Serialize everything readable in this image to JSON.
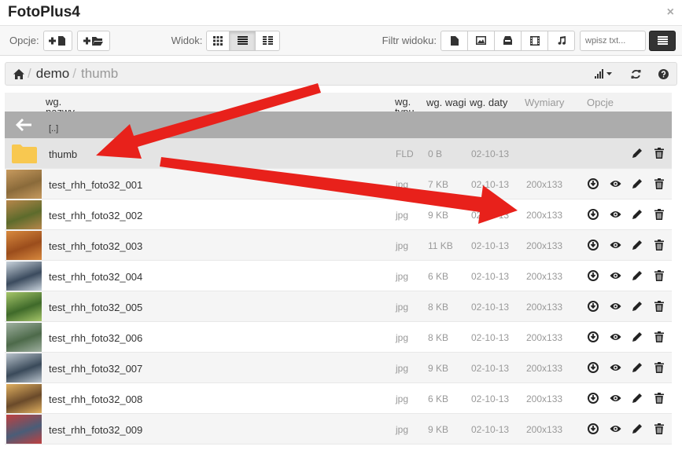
{
  "app": {
    "title": "FotoPlus4",
    "close_glyph": "×"
  },
  "toolbar": {
    "options_label": "Opcje:",
    "view_label": "Widok:",
    "filter_label": "Filtr widoku:",
    "search_placeholder": "wpisz txt..."
  },
  "breadcrumb": {
    "items": [
      "demo",
      "thumb"
    ],
    "separator": "/"
  },
  "columns": {
    "name": "wg. nazwy",
    "type": "wg. typu",
    "size": "wg. wagi",
    "date": "wg. daty",
    "dimensions": "Wymiary",
    "options": "Opcje"
  },
  "parent_label": "[..]",
  "rows": [
    {
      "name": "thumb",
      "type": "FLD",
      "size": "0 B",
      "date": "02-10-13",
      "dim": ""
    },
    {
      "name": "test_rhh_foto32_001",
      "type": "jpg",
      "size": "7 KB",
      "date": "02-10-13",
      "dim": "200x133"
    },
    {
      "name": "test_rhh_foto32_002",
      "type": "jpg",
      "size": "9 KB",
      "date": "02-10-13",
      "dim": "200x133"
    },
    {
      "name": "test_rhh_foto32_003",
      "type": "jpg",
      "size": "11 KB",
      "date": "02-10-13",
      "dim": "200x133"
    },
    {
      "name": "test_rhh_foto32_004",
      "type": "jpg",
      "size": "6 KB",
      "date": "02-10-13",
      "dim": "200x133"
    },
    {
      "name": "test_rhh_foto32_005",
      "type": "jpg",
      "size": "8 KB",
      "date": "02-10-13",
      "dim": "200x133"
    },
    {
      "name": "test_rhh_foto32_006",
      "type": "jpg",
      "size": "8 KB",
      "date": "02-10-13",
      "dim": "200x133"
    },
    {
      "name": "test_rhh_foto32_007",
      "type": "jpg",
      "size": "9 KB",
      "date": "02-10-13",
      "dim": "200x133"
    },
    {
      "name": "test_rhh_foto32_008",
      "type": "jpg",
      "size": "6 KB",
      "date": "02-10-13",
      "dim": "200x133"
    },
    {
      "name": "test_rhh_foto32_009",
      "type": "jpg",
      "size": "9 KB",
      "date": "02-10-13",
      "dim": "200x133"
    }
  ],
  "colors": {
    "annotation_arrow": "#e8211b",
    "folder": "#f8c850",
    "back_row": "#acacac"
  }
}
